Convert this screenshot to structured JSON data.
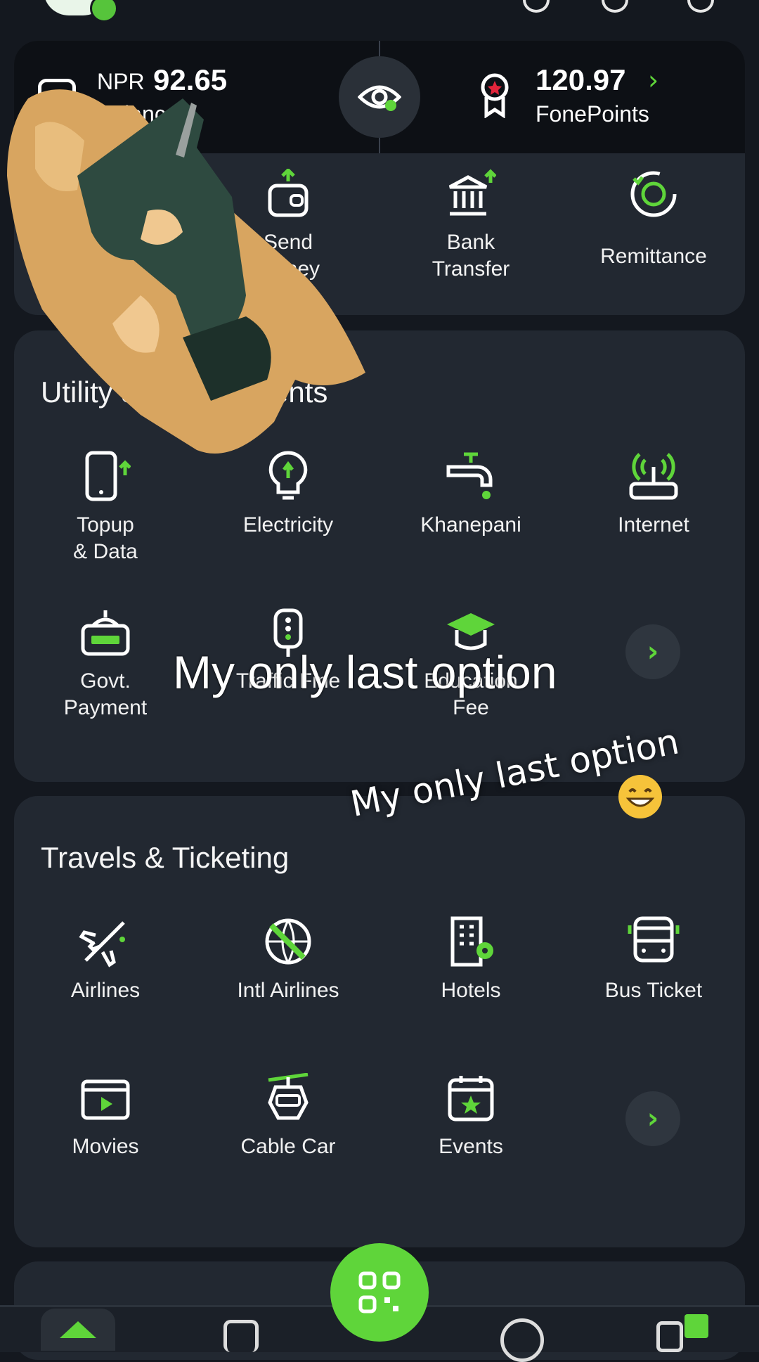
{
  "balance": {
    "currency": "NPR",
    "amount": "92.65",
    "label": "Balance",
    "points_amount": "120.97",
    "points_label": "FonePoints"
  },
  "quick_actions": [
    {
      "label": "Send\nMoney",
      "icon": "send-money-icon"
    },
    {
      "label": "Bank\nTransfer",
      "icon": "bank-transfer-icon"
    },
    {
      "label": "Remittance",
      "icon": "remittance-icon"
    }
  ],
  "utility": {
    "title": "Utility & Bill Payments",
    "items": [
      {
        "label": "Topup\n& Data",
        "icon": "topup-icon"
      },
      {
        "label": "Electricity",
        "icon": "electricity-icon"
      },
      {
        "label": "Khanepani",
        "icon": "water-tap-icon"
      },
      {
        "label": "Internet",
        "icon": "router-icon"
      },
      {
        "label": "Govt.\nPayment",
        "icon": "govt-payment-icon"
      },
      {
        "label": "Traffic Fine",
        "icon": "traffic-light-icon"
      },
      {
        "label": "Education\nFee",
        "icon": "graduation-cap-icon"
      }
    ]
  },
  "travel": {
    "title": "Travels & Ticketing",
    "items": [
      {
        "label": "Airlines",
        "icon": "airplane-icon"
      },
      {
        "label": "Intl Airlines",
        "icon": "globe-airplane-icon"
      },
      {
        "label": "Hotels",
        "icon": "hotel-icon"
      },
      {
        "label": "Bus Ticket",
        "icon": "bus-icon"
      },
      {
        "label": "Movies",
        "icon": "clapperboard-icon"
      },
      {
        "label": "Cable Car",
        "icon": "cable-car-icon"
      },
      {
        "label": "Events",
        "icon": "calendar-star-icon"
      }
    ]
  },
  "overlay": {
    "caption_main": "My only last option",
    "caption_tilted": "My only last option"
  },
  "colors": {
    "accent": "#5fd53a",
    "card": "#222831",
    "background": "#14181f"
  }
}
